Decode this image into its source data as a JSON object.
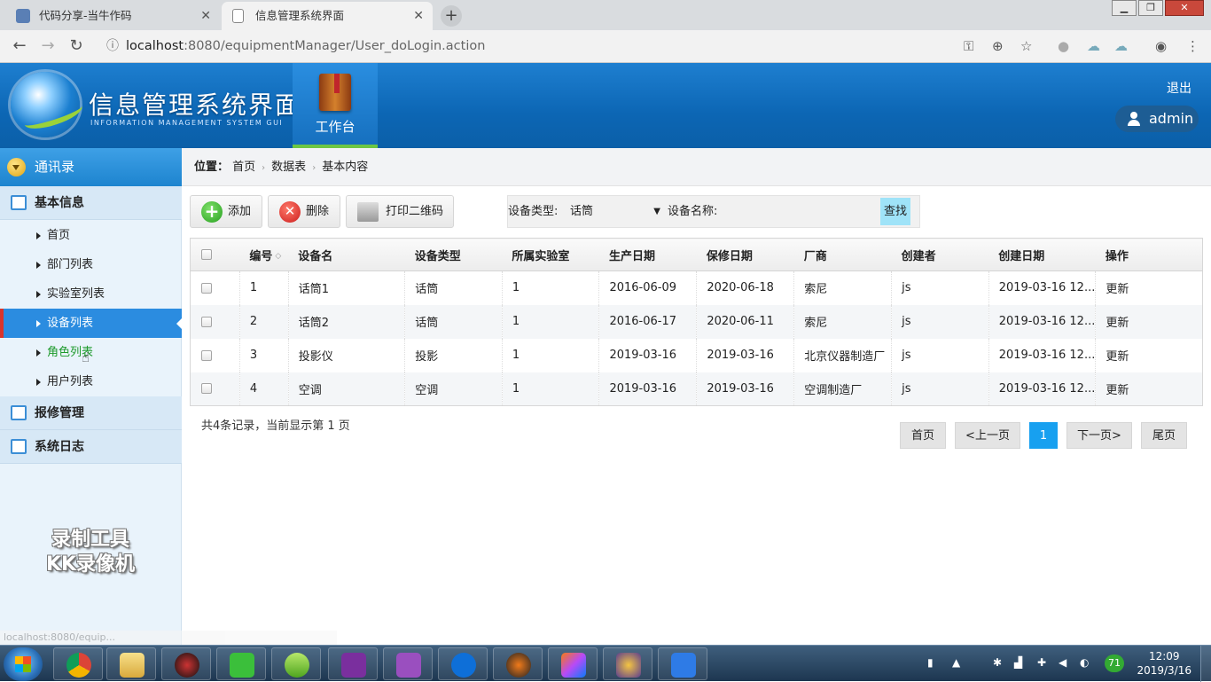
{
  "browser": {
    "tabs": [
      {
        "title": "代码分享-当牛作码",
        "close": "✕"
      },
      {
        "title": "信息管理系统界面",
        "close": "✕"
      }
    ],
    "new_tab": "+",
    "window_buttons": {
      "minimize": "▁",
      "maximize": "❐",
      "close": "✕"
    },
    "nav": {
      "back": "←",
      "forward": "→",
      "reload": "↻"
    },
    "url_host": "localhost",
    "url_path": ":8080/equipmentManager/User_doLogin.action",
    "toolbar_icons": [
      "key-icon",
      "zoom-icon",
      "star-icon",
      "extension-icon",
      "cloud-icon",
      "sync-icon",
      "account-icon",
      "menu-icon"
    ],
    "status_url": "localhost:8080/equip..."
  },
  "header": {
    "title": "信息管理系统界面",
    "subtitle": "INFORMATION MANAGEMENT SYSTEM GUI",
    "workbench_label": "工作台",
    "logout": "退出",
    "user": "admin"
  },
  "sidebar": {
    "top": "通讯录",
    "groups": [
      {
        "label": "基本信息",
        "items": [
          "首页",
          "部门列表",
          "实验室列表",
          "设备列表",
          "角色列表",
          "用户列表"
        ]
      },
      {
        "label": "报修管理"
      },
      {
        "label": "系统日志"
      }
    ],
    "active_item": "设备列表",
    "watermark_line1": "录制工具",
    "watermark_line2": "KK录像机"
  },
  "breadcrumb": {
    "label": "位置：",
    "items": [
      "首页",
      "数据表",
      "基本内容"
    ],
    "sep": "›"
  },
  "toolbar": {
    "add": "添加",
    "delete": "删除",
    "print": "打印二维码"
  },
  "search": {
    "type_label": "设备类型:",
    "type_value": "话筒",
    "name_label": "设备名称:",
    "name_value": "",
    "button": "查找"
  },
  "table": {
    "columns": [
      "编号",
      "设备名",
      "设备类型",
      "所属实验室",
      "生产日期",
      "保修日期",
      "厂商",
      "创建者",
      "创建日期",
      "操作"
    ],
    "rows": [
      [
        "1",
        "话筒1",
        "话筒",
        "1",
        "2016-06-09",
        "2020-06-18",
        "索尼",
        "js",
        "2019-03-16 12...",
        "更新"
      ],
      [
        "2",
        "话筒2",
        "话筒",
        "1",
        "2016-06-17",
        "2020-06-11",
        "索尼",
        "js",
        "2019-03-16 12...",
        "更新"
      ],
      [
        "3",
        "投影仪",
        "投影",
        "1",
        "2019-03-16",
        "2019-03-16",
        "北京仪器制造厂",
        "js",
        "2019-03-16 12...",
        "更新"
      ],
      [
        "4",
        "空调",
        "空调",
        "1",
        "2019-03-16",
        "2019-03-16",
        "空调制造厂",
        "js",
        "2019-03-16 12...",
        "更新"
      ]
    ]
  },
  "footer": {
    "info": "共4条记录，当前显示第 1 页",
    "pager": {
      "first": "首页",
      "prev": "<上一页",
      "current": "1",
      "next": "下一页>",
      "last": "尾页"
    }
  },
  "taskbar": {
    "apps": [
      "chrome",
      "explorer",
      "media-player",
      "wechat",
      "chat",
      "onenote",
      "onenote-notebook",
      "teamviewer",
      "ninja",
      "intellij",
      "java-ee",
      "wps"
    ],
    "tray_badge": "71",
    "time": "12:09",
    "date": "2019/3/16"
  }
}
